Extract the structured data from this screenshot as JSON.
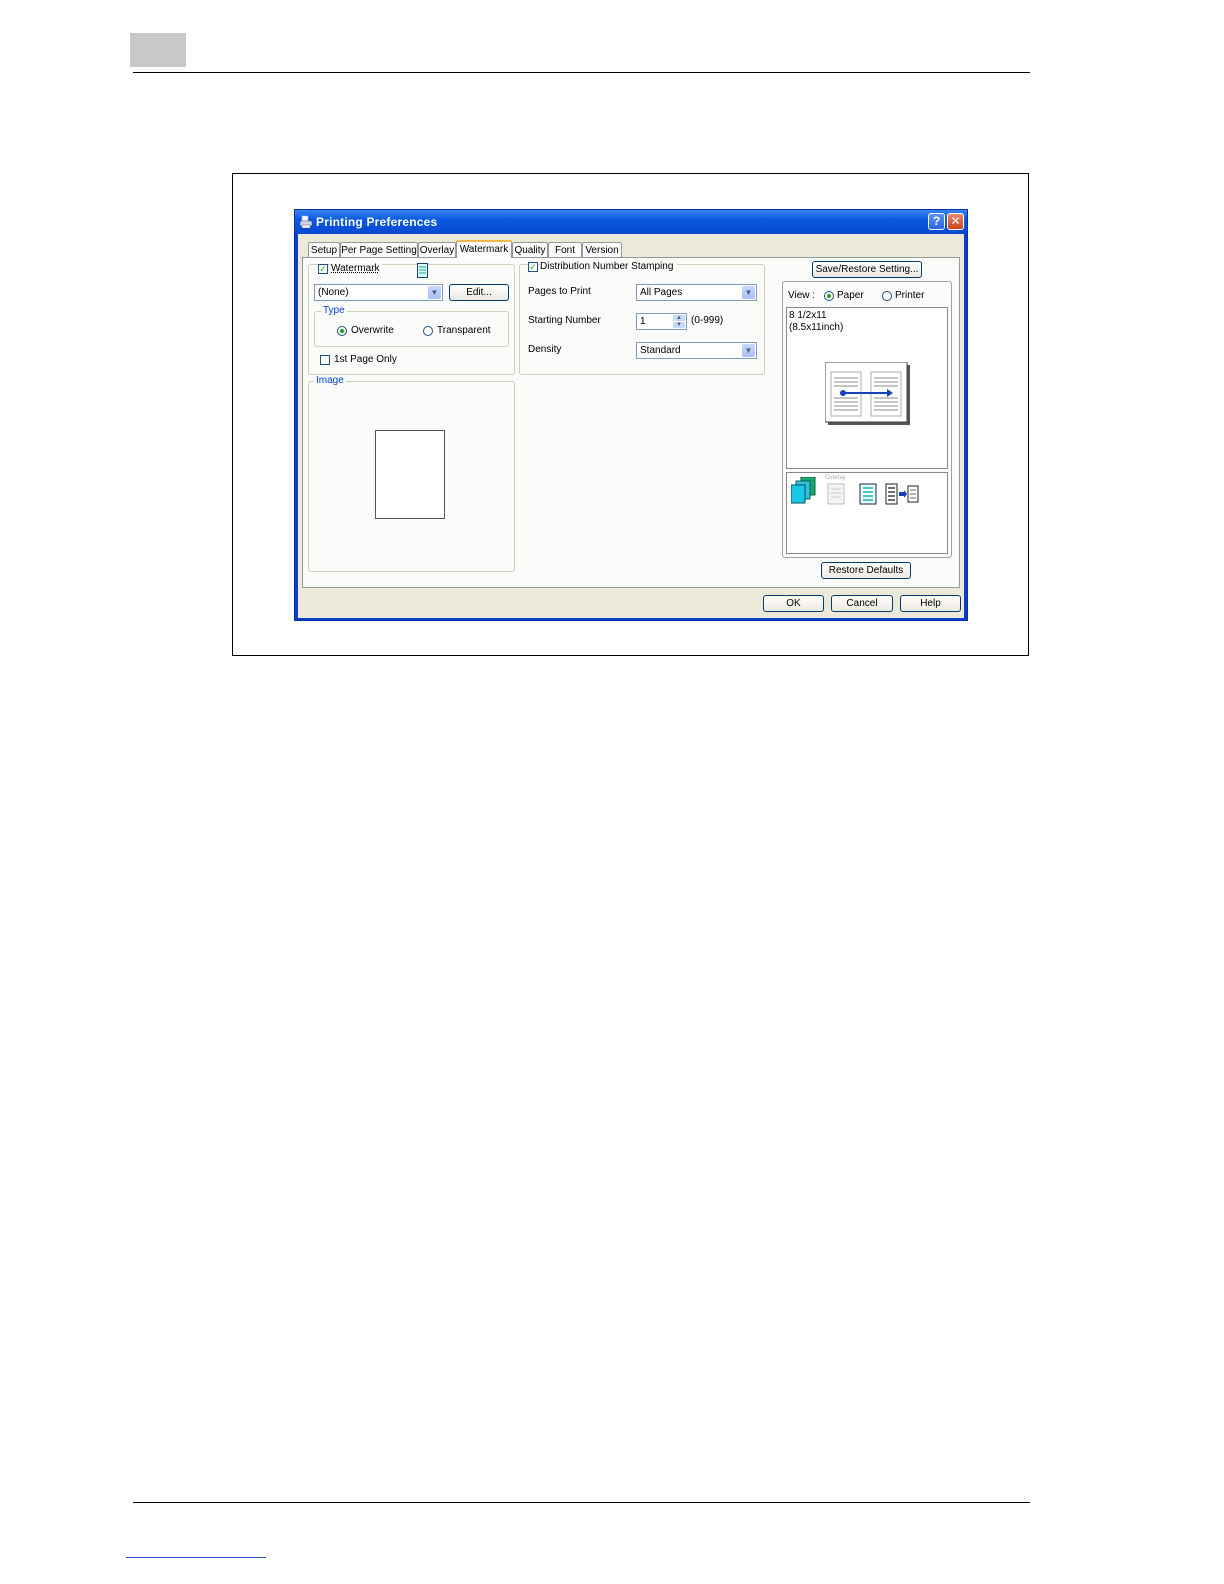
{
  "dialog": {
    "title": "Printing Preferences",
    "help_glyph": "?",
    "close_glyph": "✕"
  },
  "tabs": [
    "Setup",
    "Per Page Setting",
    "Overlay",
    "Watermark",
    "Quality",
    "Font",
    "Version"
  ],
  "active_tab": "Watermark",
  "watermark": {
    "checkbox_label": "Watermark",
    "checked": true,
    "selected": "(None)",
    "edit_button": "Edit...",
    "type_group": "Type",
    "overwrite_label": "Overwrite",
    "transparent_label": "Transparent",
    "type_selected": "Overwrite",
    "first_page_only_label": "1st Page Only",
    "first_page_only_checked": false,
    "image_group": "Image"
  },
  "distribution": {
    "checkbox_label": "Distribution Number Stamping",
    "checked": true,
    "pages_to_print_label": "Pages to Print",
    "pages_to_print_value": "All Pages",
    "starting_number_label": "Starting Number",
    "starting_number_value": "1",
    "starting_number_range": "(0-999)",
    "density_label": "Density",
    "density_value": "Standard"
  },
  "preview": {
    "save_restore_button": "Save/Restore Setting...",
    "view_label": "View :",
    "paper_label": "Paper",
    "printer_label": "Printer",
    "view_selected": "Paper",
    "paper_size_line1": "8 1/2x11",
    "paper_size_line2": "(8.5x11inch)",
    "overlay_icon_caption": "Overlay",
    "restore_defaults_button": "Restore Defaults"
  },
  "footer": {
    "ok": "OK",
    "cancel": "Cancel",
    "help": "Help"
  },
  "colors": {
    "titlebar": "#0a5ae0",
    "group_label": "#0046d5",
    "check_mark": "#21a121"
  }
}
